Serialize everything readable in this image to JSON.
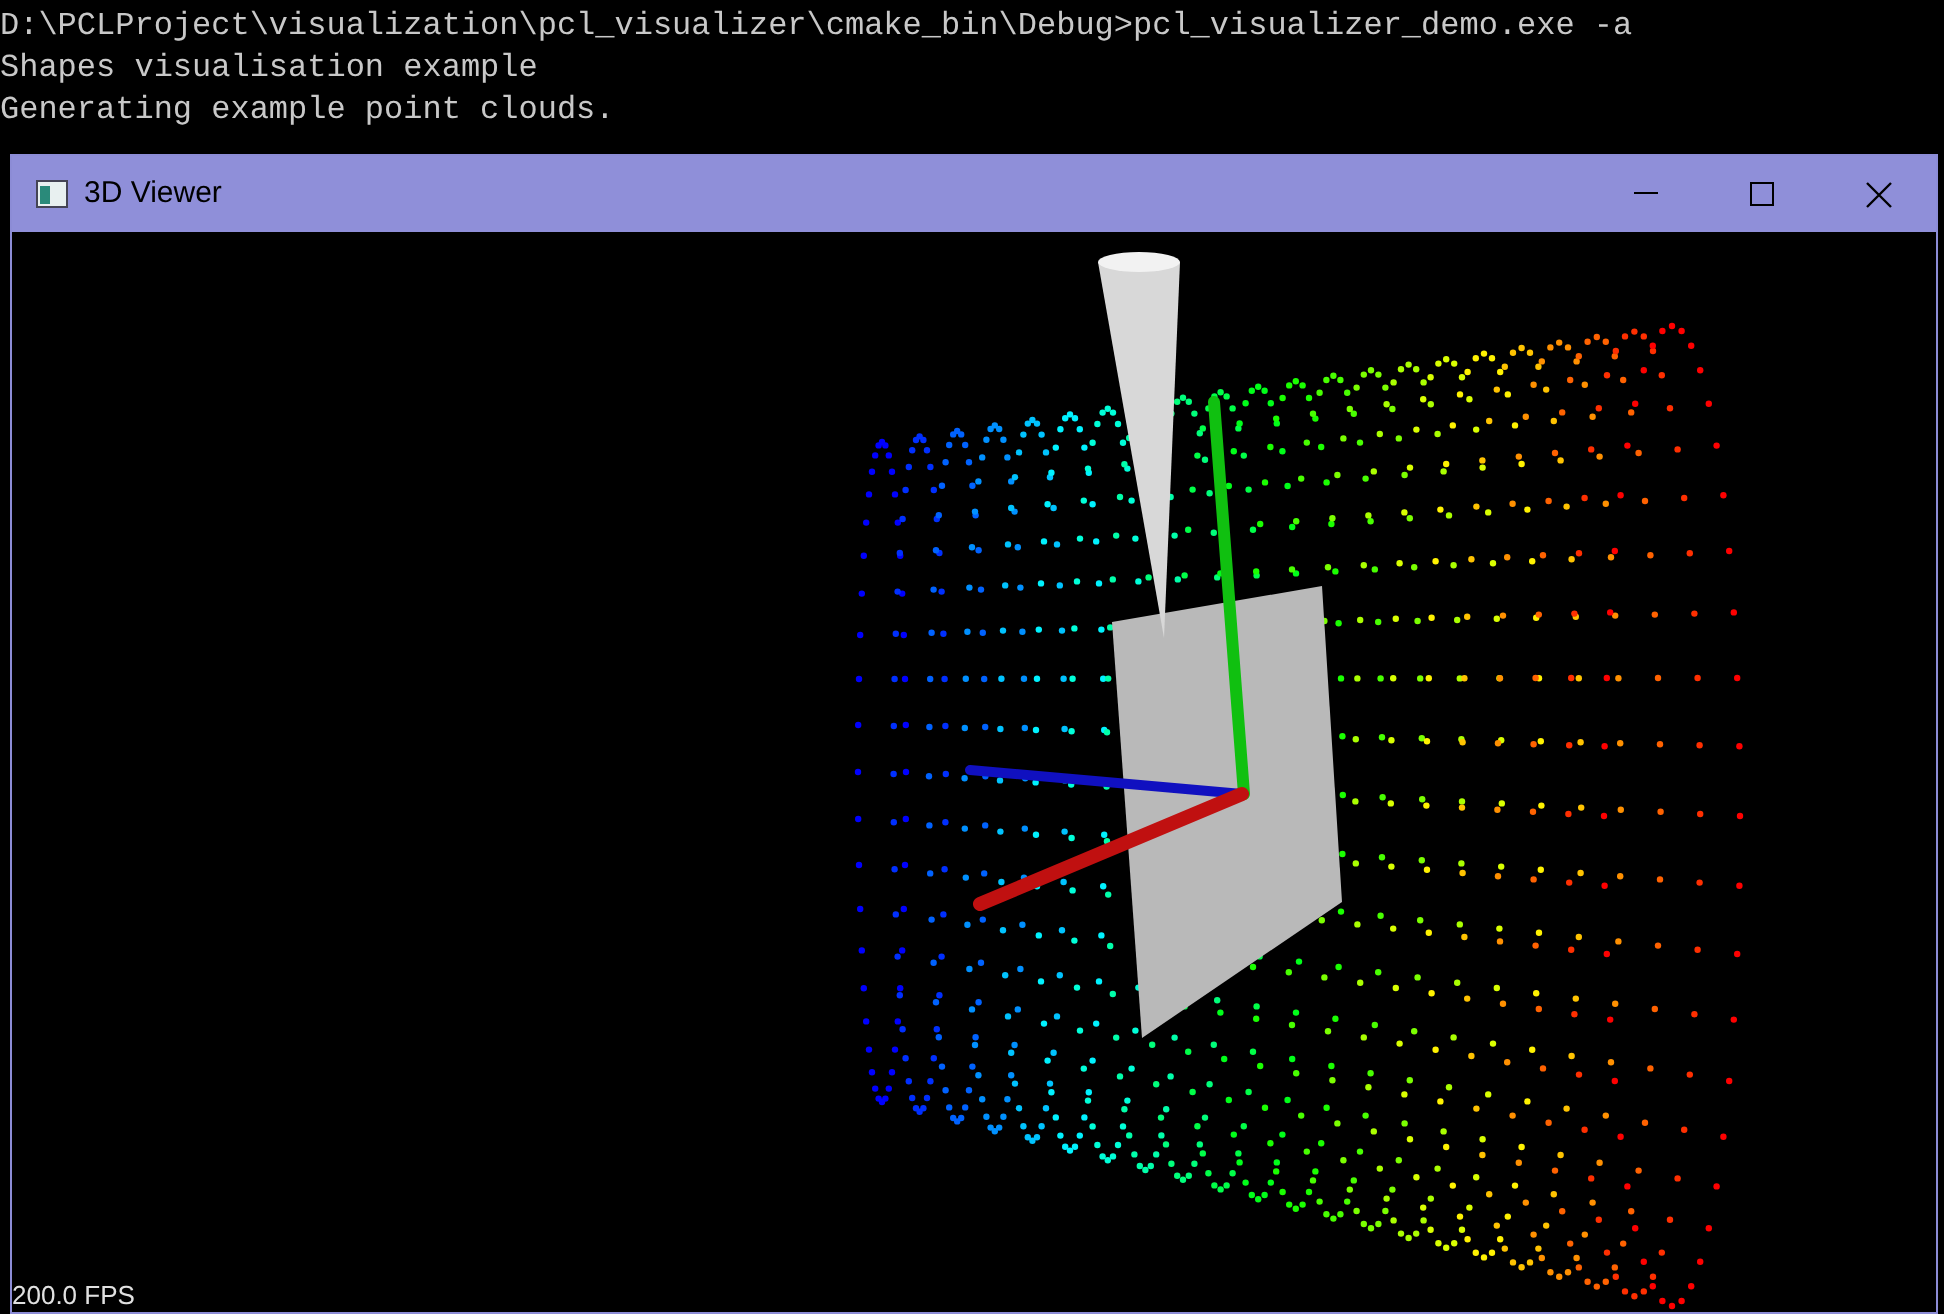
{
  "console": {
    "lines": [
      "D:\\PCLProject\\visualization\\pcl_visualizer\\cmake_bin\\Debug>pcl_visualizer_demo.exe -a",
      "Shapes visualisation example",
      "Generating example point clouds."
    ]
  },
  "viewer": {
    "title": "3D Viewer",
    "fps": "200.0 FPS"
  }
}
